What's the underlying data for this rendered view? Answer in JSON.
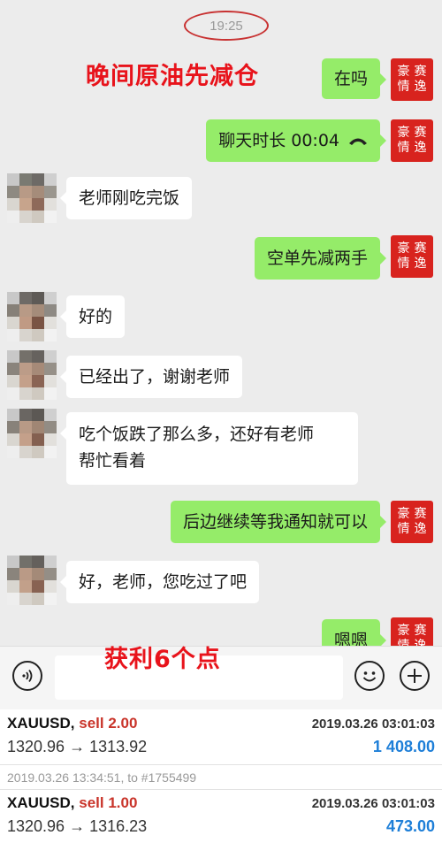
{
  "chat": {
    "timestamp": "19:25",
    "overlay_top": "晚间原油先减仓",
    "overlay_bottom": "获利6个点",
    "seal_chars": [
      "豪",
      "赛",
      "情",
      "逸"
    ],
    "messages": [
      {
        "side": "out",
        "text": "在吗"
      },
      {
        "side": "out",
        "text": "聊天时长 00:04",
        "icon": "phone-hangup-icon"
      },
      {
        "side": "in",
        "text": "老师刚吃完饭"
      },
      {
        "side": "out",
        "text": "空单先减两手"
      },
      {
        "side": "in",
        "text": "好的"
      },
      {
        "side": "in",
        "text": "已经出了，谢谢老师"
      },
      {
        "side": "in",
        "line1": "吃个饭跌了那么多，还好有老师",
        "line2": "帮忙看着"
      },
      {
        "side": "out",
        "text": "后边继续等我通知就可以"
      },
      {
        "side": "in",
        "text": "好，老师，您吃过了吧"
      },
      {
        "side": "out",
        "text": "嗯嗯"
      }
    ]
  },
  "input_bar": {
    "voice_icon": "voice-icon",
    "emoji_icon": "emoji-icon",
    "plus_icon": "plus-icon",
    "placeholder": ""
  },
  "trades": [
    {
      "symbol": "XAUUSD,",
      "side": "sell 2.00",
      "date": "2019.03.26 03:01:03",
      "prices": "1320.96 → 1313.92",
      "profit": "1 408.00"
    },
    {
      "note": "2019.03.26 13:34:51, to #1755499"
    },
    {
      "symbol": "XAUUSD,",
      "side": "sell 1.00",
      "date": "2019.03.26 03:01:03",
      "prices": "1320.96 → 1316.23",
      "profit": "473.00"
    }
  ],
  "colors": {
    "bubble_out": "#95ec69",
    "bubble_in": "#ffffff",
    "overlay_red": "#e8131b",
    "seal_red": "#d8231e",
    "sell_red": "#c9342a",
    "profit_blue": "#1e7fd8"
  }
}
